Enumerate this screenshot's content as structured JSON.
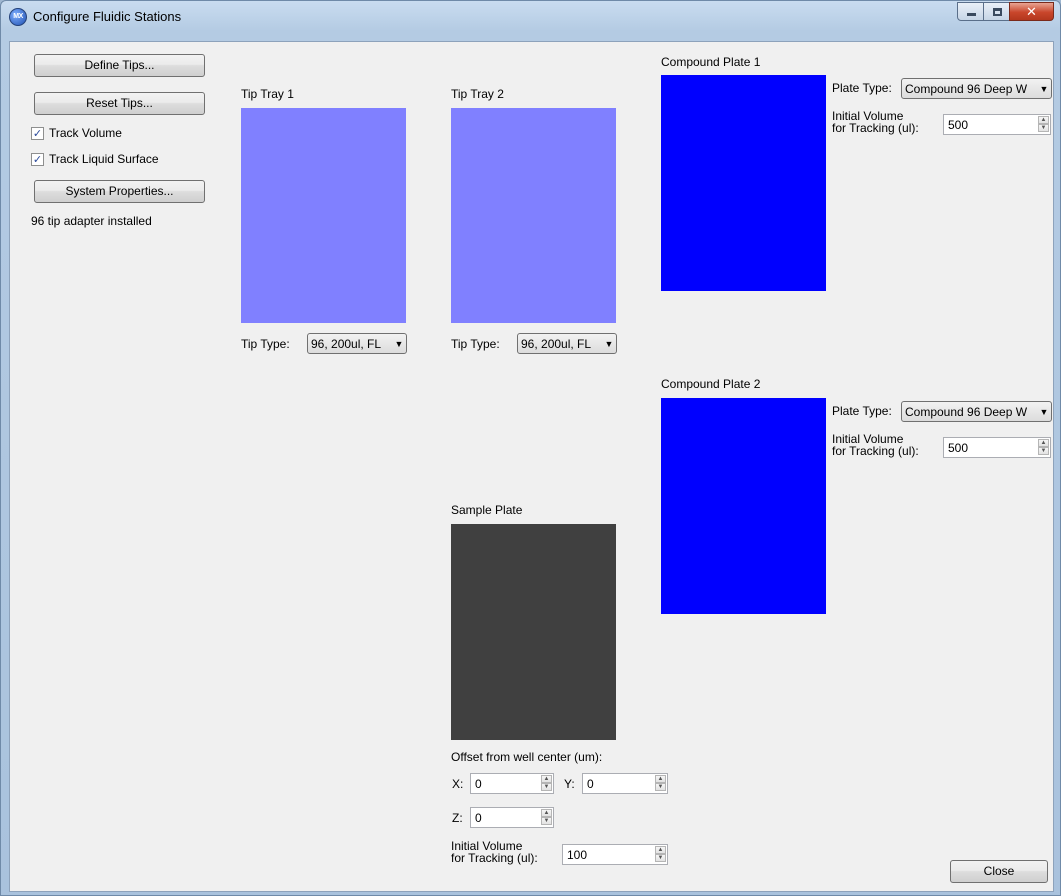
{
  "window": {
    "title": "Configure Fluidic Stations",
    "app_icon_text": "MX"
  },
  "left_panel": {
    "define_tips": "Define Tips...",
    "reset_tips": "Reset Tips...",
    "track_volume": {
      "label": "Track Volume",
      "checked": true
    },
    "track_liquid_surface": {
      "label": "Track Liquid Surface",
      "checked": true
    },
    "system_properties": "System Properties...",
    "status": "96 tip adapter installed"
  },
  "tip_tray_1": {
    "title": "Tip Tray 1",
    "color": "#8080ff",
    "tip_type_label": "Tip Type:",
    "tip_type_value": "96, 200ul, FL"
  },
  "tip_tray_2": {
    "title": "Tip Tray 2",
    "color": "#8080ff",
    "tip_type_label": "Tip Type:",
    "tip_type_value": "96, 200ul, FL"
  },
  "compound_plate_1": {
    "title": "Compound Plate 1",
    "color": "#0000ff",
    "plate_type_label": "Plate Type:",
    "plate_type_value": "Compound 96 Deep W",
    "initial_volume_label_1": "Initial Volume",
    "initial_volume_label_2": "for Tracking (ul):",
    "initial_volume_value": "500"
  },
  "compound_plate_2": {
    "title": "Compound Plate 2",
    "color": "#0000ff",
    "plate_type_label": "Plate Type:",
    "plate_type_value": "Compound 96 Deep W",
    "initial_volume_label_1": "Initial Volume",
    "initial_volume_label_2": "for Tracking (ul):",
    "initial_volume_value": "500"
  },
  "sample_plate": {
    "title": "Sample Plate",
    "color": "#404040",
    "offset_label": "Offset from well center (um):",
    "x_label": "X:",
    "x_value": "0",
    "y_label": "Y:",
    "y_value": "0",
    "z_label": "Z:",
    "z_value": "0",
    "initial_volume_label_1": "Initial Volume",
    "initial_volume_label_2": "for Tracking (ul):",
    "initial_volume_value": "100"
  },
  "footer": {
    "close": "Close"
  }
}
